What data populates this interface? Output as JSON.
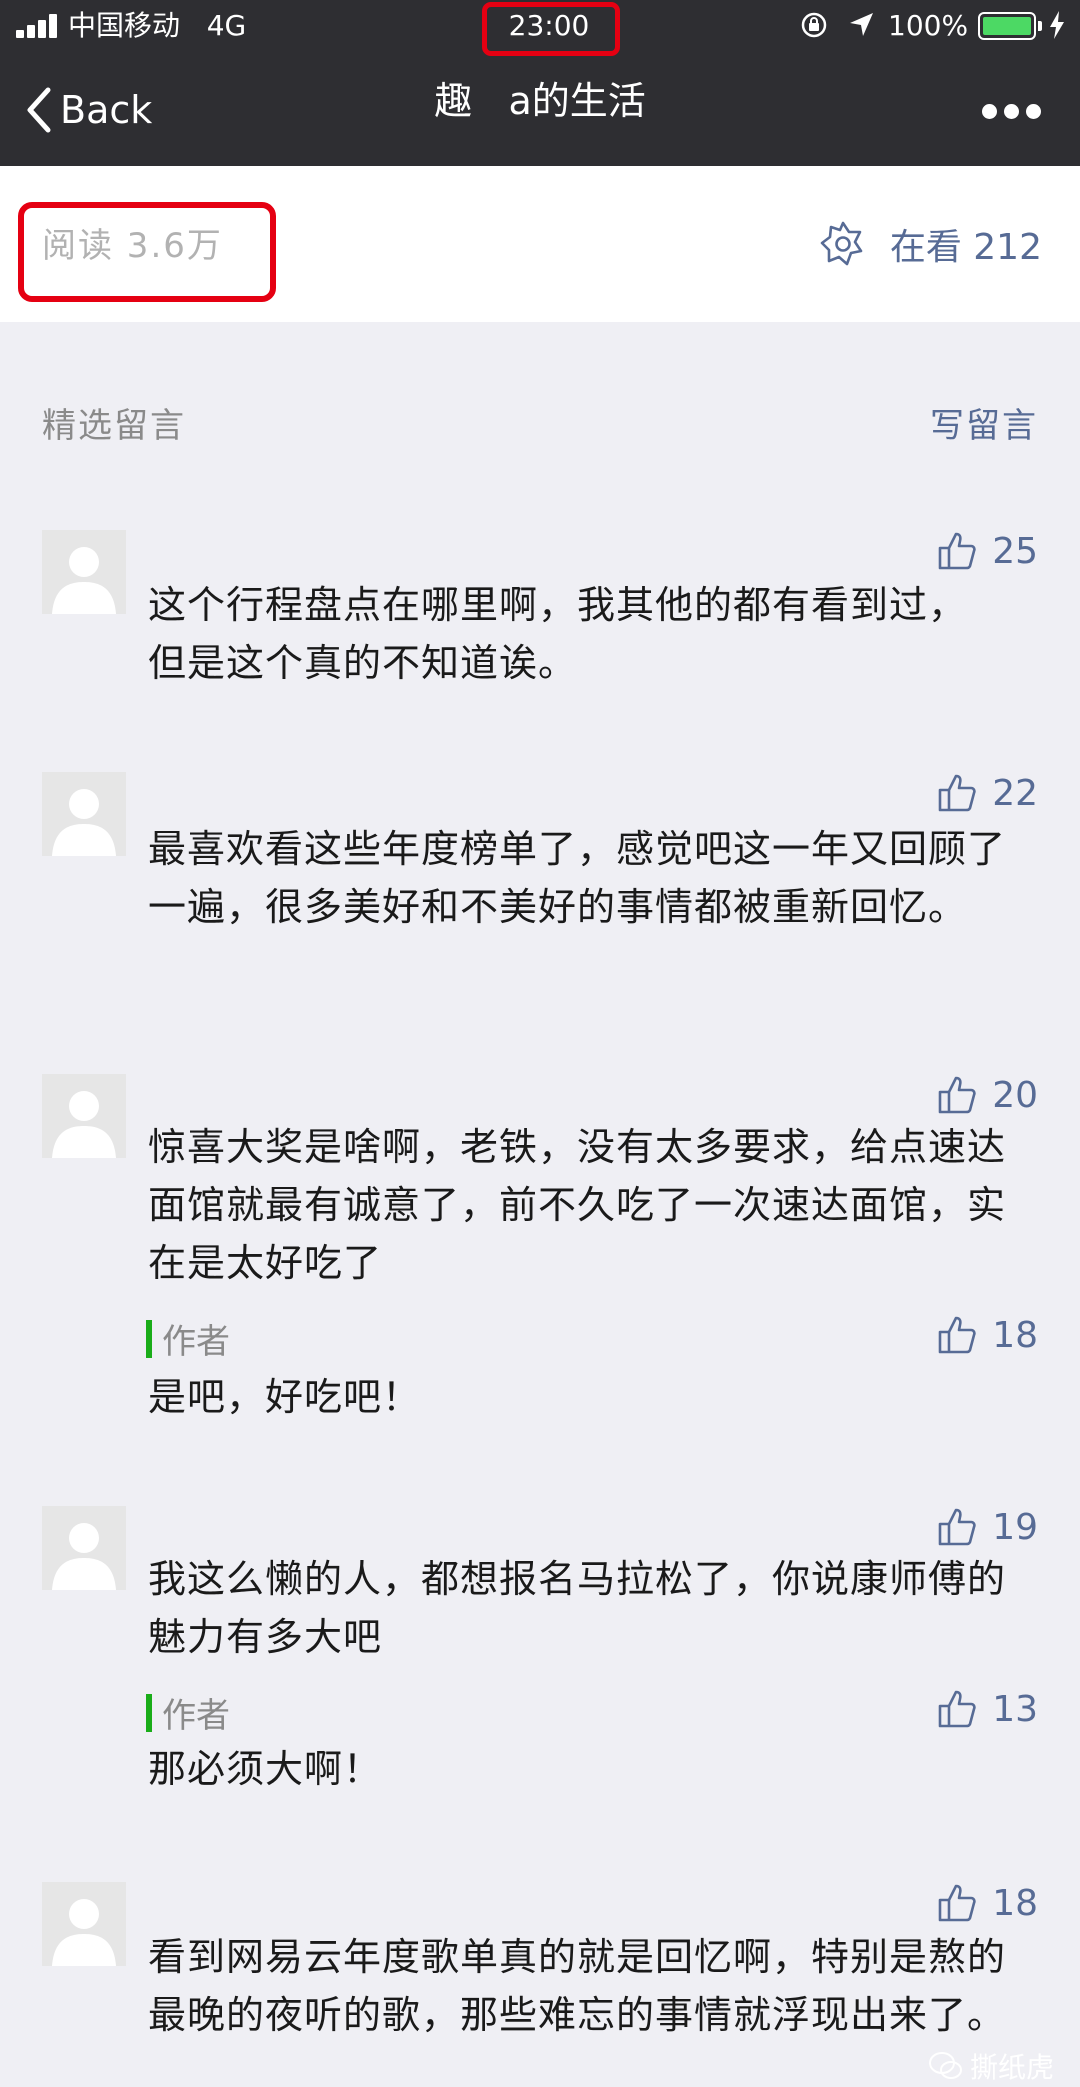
{
  "status": {
    "carrier": "中国移动",
    "network": "4G",
    "time": "23:00",
    "battery": "100%"
  },
  "nav": {
    "back": "Back",
    "title": "趣   a的生活"
  },
  "stats": {
    "reads": "阅读 3.6万",
    "seeing": "在看 212"
  },
  "section": {
    "title": "精选留言",
    "write": "写留言"
  },
  "comments": [
    {
      "likes": "25",
      "text": "这个行程盘点在哪里啊，我其他的都有看到过，但是这个真的不知道诶。"
    },
    {
      "likes": "22",
      "text": "最喜欢看这些年度榜单了，感觉吧这一年又回顾了一遍，很多美好和不美好的事情都被重新回忆。"
    },
    {
      "likes": "20",
      "text": "惊喜大奖是啥啊，老铁，没有太多要求，给点速达面馆就最有诚意了，前不久吃了一次速达面馆，实在是太好吃了",
      "reply": {
        "label": "作者",
        "likes": "18",
        "text": "是吧，好吃吧！"
      }
    },
    {
      "likes": "19",
      "text": "我这么懒的人，都想报名马拉松了，你说康师傅的魅力有多大吧",
      "reply": {
        "label": "作者",
        "likes": "13",
        "text": "那必须大啊！"
      }
    },
    {
      "likes": "18",
      "text": "看到网易云年度歌单真的就是回忆啊，特别是熬的最晚的夜听的歌，那些难忘的事情就浮现出来了。"
    }
  ],
  "watermark": "撕纸虎",
  "colors": {
    "navbar": "#2e2e32",
    "link": "#576b95",
    "highlight": "#e50012",
    "author_bar": "#1aad19",
    "battery": "#4cd964"
  }
}
